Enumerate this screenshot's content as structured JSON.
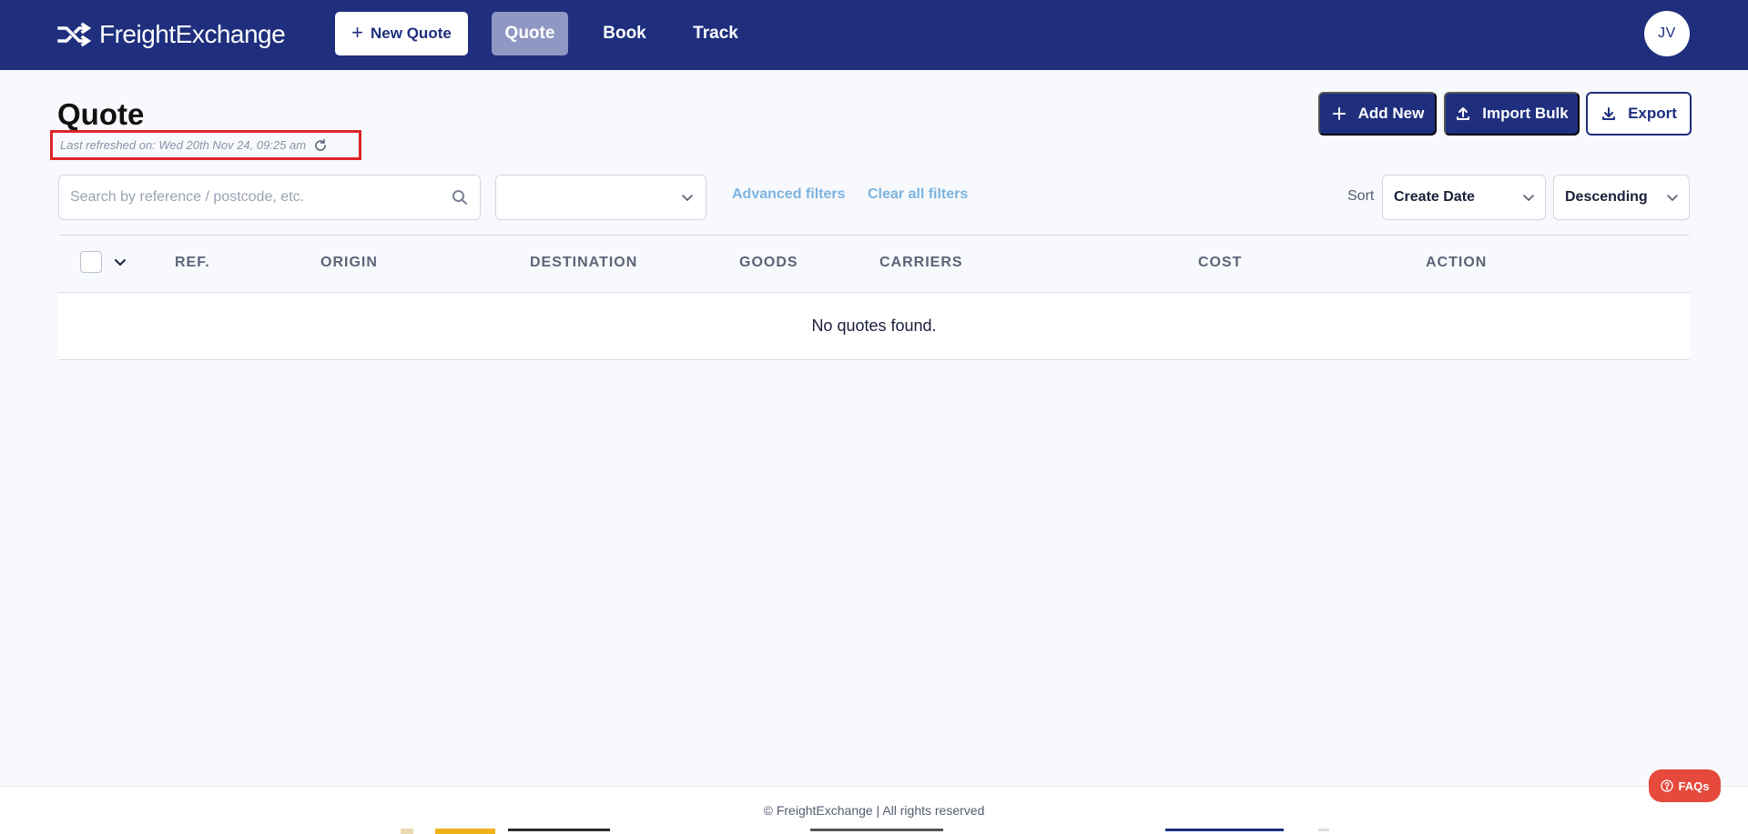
{
  "app": {
    "brand": "FreightExchange",
    "new_quote_label": "New Quote",
    "tabs": [
      {
        "label": "Quote",
        "active": true
      },
      {
        "label": "Book",
        "active": false
      },
      {
        "label": "Track",
        "active": false
      }
    ],
    "avatar_initials": "JV"
  },
  "page": {
    "title": "Quote",
    "last_refreshed": "Last refreshed on: Wed 20th Nov 24, 09:25 am",
    "actions": {
      "add_new": "Add New",
      "import_bulk": "Import Bulk",
      "export": "Export"
    }
  },
  "filters": {
    "search_placeholder": "Search by reference / postcode, etc.",
    "select_value": "",
    "advanced_filters": "Advanced filters",
    "clear_all_filters": "Clear all filters",
    "sort_label": "Sort",
    "sort_field": "Create Date",
    "sort_direction": "Descending"
  },
  "table": {
    "columns": [
      "REF.",
      "ORIGIN",
      "DESTINATION",
      "GOODS",
      "CARRIERS",
      "COST",
      "ACTION"
    ],
    "empty_message": "No quotes found."
  },
  "footer": {
    "copyright": "© FreightExchange | All rights reserved",
    "faqs_label": "FAQs"
  },
  "colors": {
    "primary": "#1f2f7e",
    "active_tab": "#8f97c3",
    "link": "#7cb4e0",
    "highlight_border": "#e0242a",
    "faqs": "#e64a3d",
    "background": "#f7f9fc"
  },
  "icons": {
    "logo": "shuffle-arrows-icon",
    "refresh": "refresh-icon",
    "search": "search-icon",
    "add": "plus-icon",
    "import": "upload-icon",
    "export": "download-icon",
    "dropdown": "chevron-down-icon",
    "help": "question-circle-icon"
  }
}
